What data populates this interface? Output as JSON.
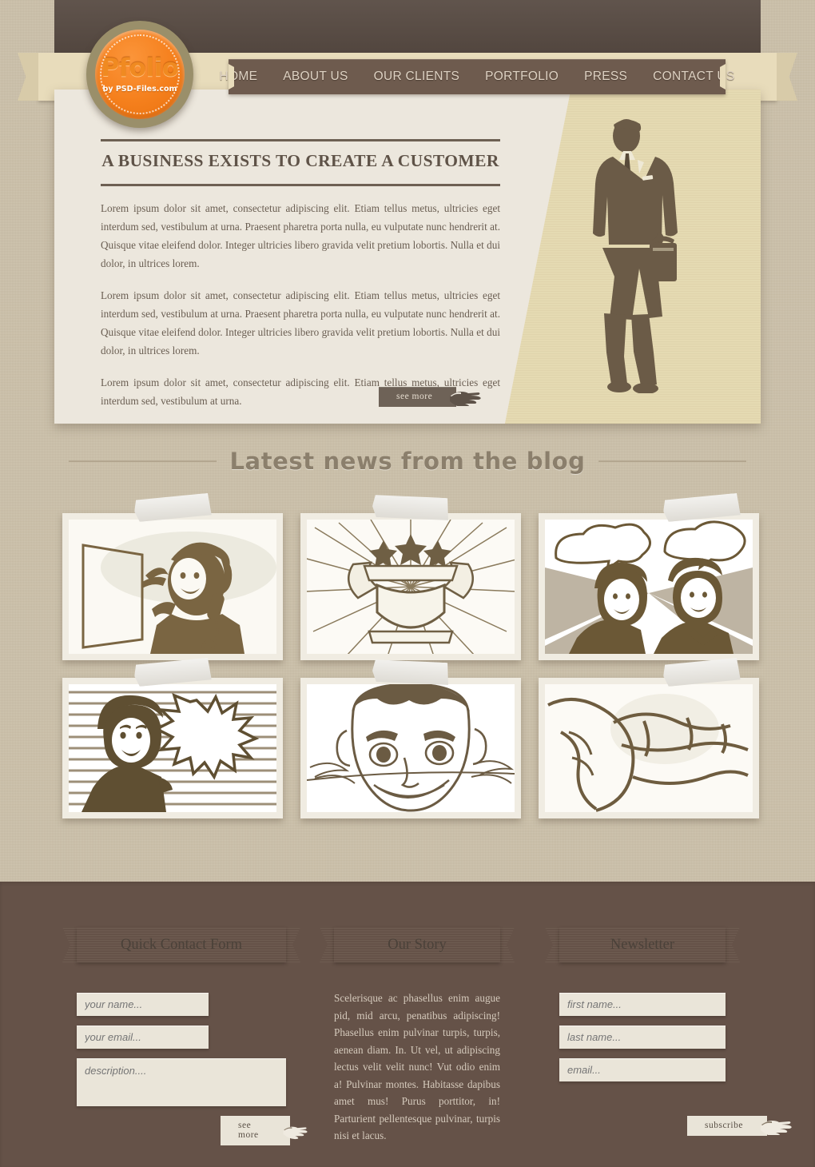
{
  "brand": {
    "name": "Pfolio",
    "tagline": "by PSD-Files.com"
  },
  "nav": {
    "items": [
      {
        "label": "HOME"
      },
      {
        "label": "ABOUT US"
      },
      {
        "label": "OUR CLIENTS"
      },
      {
        "label": "PORTFOLIO"
      },
      {
        "label": "PRESS"
      },
      {
        "label": "CONTACT US"
      }
    ]
  },
  "hero": {
    "title": "A BUSINESS EXISTS TO CREATE A CUSTOMER",
    "paragraphs": [
      "Lorem ipsum dolor sit amet, consectetur adipiscing elit. Etiam tellus metus, ultricies eget interdum sed, vestibulum at urna. Praesent pharetra porta nulla, eu vulputate nunc hendrerit at. Quisque vitae eleifend dolor. Integer ultricies libero gravida velit pretium lobortis. Nulla et dui dolor, in ultrices lorem.",
      "Lorem ipsum dolor sit amet, consectetur adipiscing elit. Etiam tellus metus, ultricies eget interdum sed, vestibulum at urna. Praesent pharetra porta nulla, eu vulputate nunc hendrerit at. Quisque vitae eleifend dolor. Integer ultricies libero gravida velit pretium lobortis. Nulla et dui dolor, in ultrices lorem.",
      "Lorem ipsum dolor sit amet, consectetur adipiscing elit. Etiam tellus metus, ultricies eget interdum sed, vestibulum at urna."
    ],
    "see_more_label": "see more",
    "illustration": "vintage-businessman-with-briefcase"
  },
  "blog": {
    "heading": "Latest news from the blog",
    "thumbnails": [
      {
        "alt": "retro-woman-on-telephone-writing-on-board"
      },
      {
        "alt": "heraldic-crest-shield-with-stars-and-banner"
      },
      {
        "alt": "pop-art-couple-with-speech-bubbles"
      },
      {
        "alt": "retro-woman-with-starburst-speech-bubble"
      },
      {
        "alt": "smiling-man-close-up-sketch"
      },
      {
        "alt": "flexing-arm-muscle-illustration"
      }
    ]
  },
  "footer": {
    "contact": {
      "title": "Quick Contact Form",
      "name_placeholder": "your name...",
      "email_placeholder": "your email...",
      "description_placeholder": "description....",
      "submit_label": "see more"
    },
    "story": {
      "title": "Our Story",
      "text": "Scelerisque ac phasellus enim augue pid, mid arcu, penatibus adipiscing! Phasellus enim pulvinar turpis, turpis, aenean diam. In. Ut vel, ut adipiscing lectus velit velit nunc! Vut odio enim a! Pulvinar montes. Habitasse dapibus amet mus! Purus porttitor, in! Parturient pellentesque pulvinar, turpis nisi et lacus."
    },
    "newsletter": {
      "title": "Newsletter",
      "first_name_placeholder": "first name...",
      "last_name_placeholder": "last name...",
      "email_placeholder": "email...",
      "subscribe_label": "subscribe"
    }
  },
  "colors": {
    "page_bg": "#cbc0a9",
    "header_dark": "#584b43",
    "nav_plate": "#6e5b4e",
    "ribbon_cream": "#e8dcbb",
    "hero_bg": "#ece7dd",
    "hero_panel": "#e5dab2",
    "accent_orange": "#f5801d",
    "footer_bg": "#655248",
    "text_brown": "#6a5e52"
  }
}
